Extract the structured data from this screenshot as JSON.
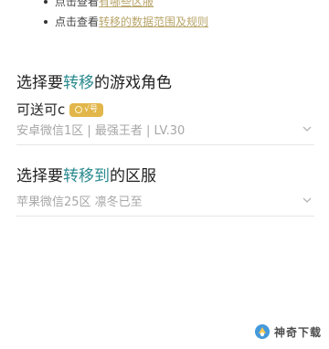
{
  "notes": [
    {
      "prefix": "点击查看",
      "link": "有哪些区服"
    },
    {
      "prefix": "点击查看",
      "link": "转移的数据范围及规则"
    }
  ],
  "section_role": {
    "title_before": "选择要",
    "title_highlight": "转移",
    "title_after": "的游戏角色",
    "role_name": "可送可c",
    "role_badge": "√号",
    "role_detail": "安卓微信1区 | 最强王者 | LV.30"
  },
  "section_server": {
    "title_before": "选择要",
    "title_highlight": "转移到",
    "title_after": "的区服",
    "server_detail": "苹果微信25区 凛冬已至"
  },
  "watermark": {
    "text": "神奇下载"
  },
  "colors": {
    "highlight": "#2a8a8f",
    "link": "#b9a56a",
    "badge": "#e2b64a",
    "muted_text": "#a7a7a7"
  }
}
